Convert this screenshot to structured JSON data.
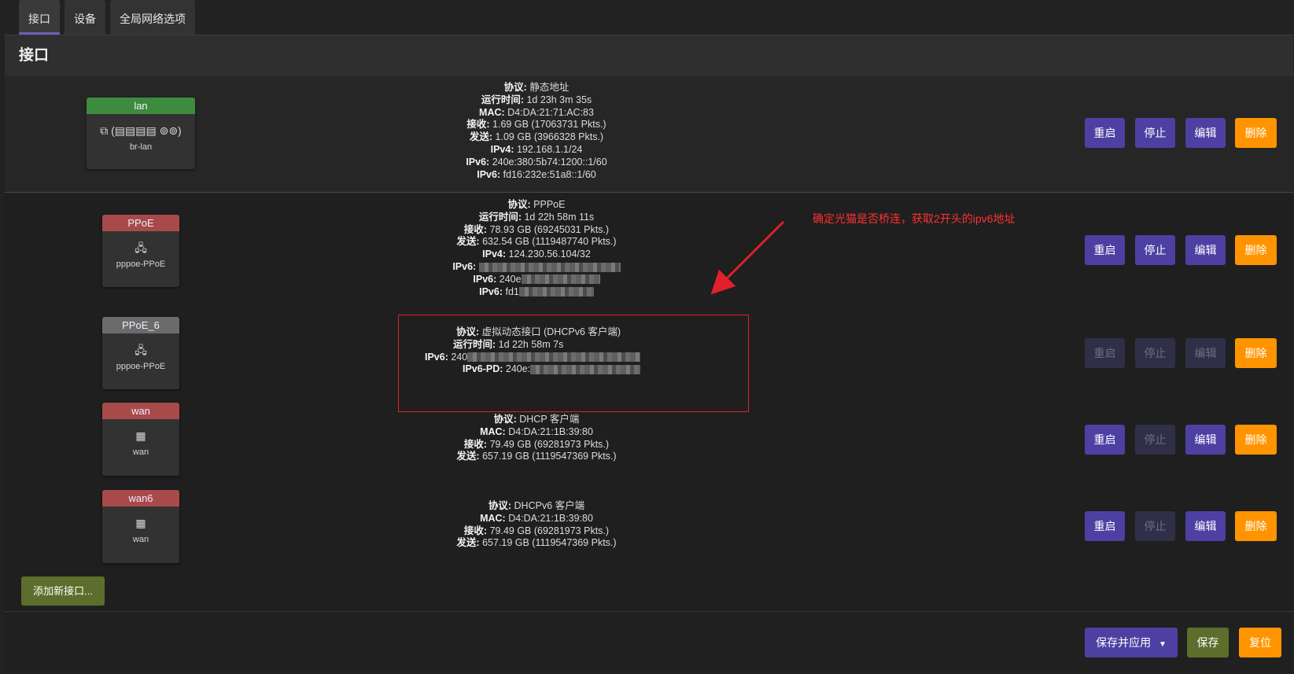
{
  "tabs": [
    "接口",
    "设备",
    "全局网络选项"
  ],
  "panel_title": "接口",
  "interfaces": [
    {
      "name": "lan",
      "header_color": "#3d8b3d",
      "icons": "⧉ (▤▤▤▤ ⊚⊚)",
      "device": "br-lan",
      "lines": [
        {
          "k": "协议:",
          "v": " 静态地址"
        },
        {
          "k": "运行时间:",
          "v": " 1d 23h 3m 35s"
        },
        {
          "k": "MAC:",
          "v": " D4:DA:21:71:AC:83"
        },
        {
          "k": "接收:",
          "v": " 1.69 GB (17063731 Pkts.)"
        },
        {
          "k": "发送:",
          "v": " 1.09 GB (3966328 Pkts.)"
        },
        {
          "k": "IPv4:",
          "v": " 192.168.1.1/24"
        },
        {
          "k": "IPv6:",
          "v": " 240e:380:5b74:1200::1/60"
        },
        {
          "k": "IPv6:",
          "v": " fd16:232e:51a8::1/60"
        }
      ],
      "buttons": {
        "restart": true,
        "stop": true,
        "edit": true
      }
    },
    {
      "name": "PPoE",
      "header_color": "#a84a4a",
      "icons": "🖧",
      "device": "pppoe-PPoE",
      "lines": [
        {
          "k": "协议:",
          "v": " PPPoE"
        },
        {
          "k": "运行时间:",
          "v": " 1d 22h 58m 11s"
        },
        {
          "k": "接收:",
          "v": " 78.93 GB (69245031 Pkts.)"
        },
        {
          "k": "发送:",
          "v": " 632.54 GB (1119487740 Pkts.)"
        },
        {
          "k": "IPv4:",
          "v": " 124.230.56.104/32"
        },
        {
          "k": "IPv6:",
          "v": " "
        },
        {
          "k": "IPv6:",
          "v": " 240e"
        },
        {
          "k": "IPv6:",
          "v": " fd1"
        }
      ],
      "buttons": {
        "restart": true,
        "stop": true,
        "edit": true
      }
    },
    {
      "name": "PPoE_6",
      "header_color": "#6b6b6b",
      "icons": "🖧",
      "device": "pppoe-PPoE",
      "lines": [
        {
          "k": "协议:",
          "v": " 虚拟动态接口 (DHCPv6 客户端)"
        },
        {
          "k": "运行时间:",
          "v": " 1d 22h 58m 7s"
        },
        {
          "k": "IPv6:",
          "v": " 240"
        },
        {
          "k": "IPv6-PD:",
          "v": " 240e:"
        }
      ],
      "buttons": {
        "restart": false,
        "stop": false,
        "edit": false
      }
    },
    {
      "name": "wan",
      "header_color": "#a84a4a",
      "icons": "▦",
      "device": "wan",
      "lines": [
        {
          "k": "协议:",
          "v": " DHCP 客户端"
        },
        {
          "k": "MAC:",
          "v": " D4:DA:21:1B:39:80"
        },
        {
          "k": "接收:",
          "v": " 79.49 GB (69281973 Pkts.)"
        },
        {
          "k": "发送:",
          "v": " 657.19 GB (1119547369 Pkts.)"
        }
      ],
      "buttons": {
        "restart": true,
        "stop": false,
        "edit": true
      }
    },
    {
      "name": "wan6",
      "header_color": "#a84a4a",
      "icons": "▦",
      "device": "wan",
      "lines": [
        {
          "k": "协议:",
          "v": " DHCPv6 客户端"
        },
        {
          "k": "MAC:",
          "v": " D4:DA:21:1B:39:80"
        },
        {
          "k": "接收:",
          "v": " 79.49 GB (69281973 Pkts.)"
        },
        {
          "k": "发送:",
          "v": " 657.19 GB (1119547369 Pkts.)"
        }
      ],
      "buttons": {
        "restart": true,
        "stop": false,
        "edit": true
      }
    }
  ],
  "row_buttons": {
    "restart": "重启",
    "stop": "停止",
    "edit": "编辑",
    "delete": "删除"
  },
  "annotation": "确定光猫是否桥连，获取2开头的ipv6地址",
  "add_button": "添加新接口...",
  "footer": {
    "save_apply": "保存并应用",
    "save": "保存",
    "reset": "复位"
  },
  "colors": {
    "accent": "#4e40a3",
    "delete": "#ff9400",
    "add": "#5c6e2b",
    "annotation": "#e0202a"
  }
}
